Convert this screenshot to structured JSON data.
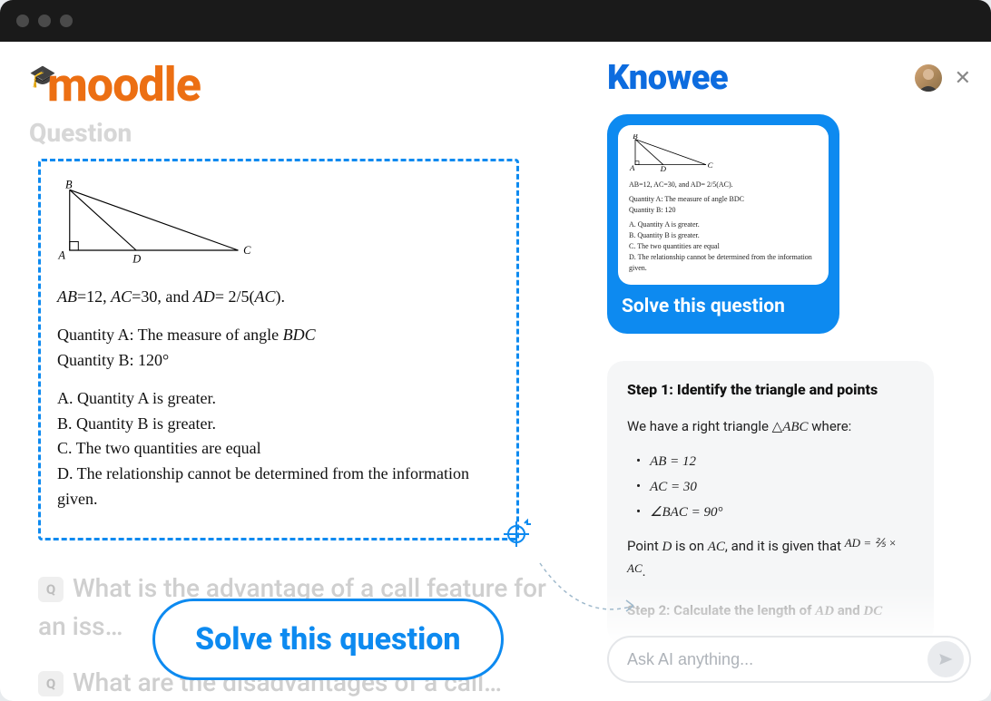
{
  "left": {
    "heading": "Question",
    "problem": {
      "line1_html": "<span class='it'>AB</span>=12, <span class='it'>AC</span>=30, and <span class='it'>AD</span>= 2/5(<span class='it'>AC</span>).",
      "qa": "Quantity A: The measure of angle BDC",
      "qb": "Quantity B: 120°",
      "optA": "A. Quantity A is greater.",
      "optB": "B. Quantity B is greater.",
      "optC": "C. The two quantities are equal",
      "optD": "D. The relationship cannot be determined from the information given."
    },
    "faded1_prefix": "Q",
    "faded1": "What is the advantage of a call feature for an iss…",
    "faded2_prefix": "Q",
    "faded2": "What are the disadvantages of a call…",
    "solve_big": "Solve this question"
  },
  "right": {
    "brand": "Knowee",
    "card_cta": "Solve this question",
    "preview": {
      "line1": "AB=12, AC=30, and AD= 2/5(AC).",
      "qa": "Quantity A: The measure of angle BDC",
      "qb": "Quantity B: 120",
      "a": "A. Quantity A is greater.",
      "b": "B. Quantity B is greater.",
      "c": "C. The two quantities are equal",
      "d": "D. The relationship cannot be determined from the information given."
    },
    "answer": {
      "step1_title": "Step 1: Identify the triangle and points",
      "intro_pre": "We have a right triangle ",
      "intro_tri": "△ABC",
      "intro_post": " where:",
      "b1": "AB = 12",
      "b2": "AC = 30",
      "b3": "∠BAC = 90°",
      "p2_pre": "Point ",
      "p2_d": "D",
      "p2_mid": " is on ",
      "p2_ac": "AC",
      "p2_mid2": ", and it is given that ",
      "p2_eq": "AD = ⅖ × AC",
      "p2_end": ".",
      "step2_pre": "Step 2: Calculate the length of ",
      "step2_ad": "AD",
      "step2_and": " and ",
      "step2_dc": "DC"
    },
    "chat_placeholder": "Ask AI anything..."
  }
}
